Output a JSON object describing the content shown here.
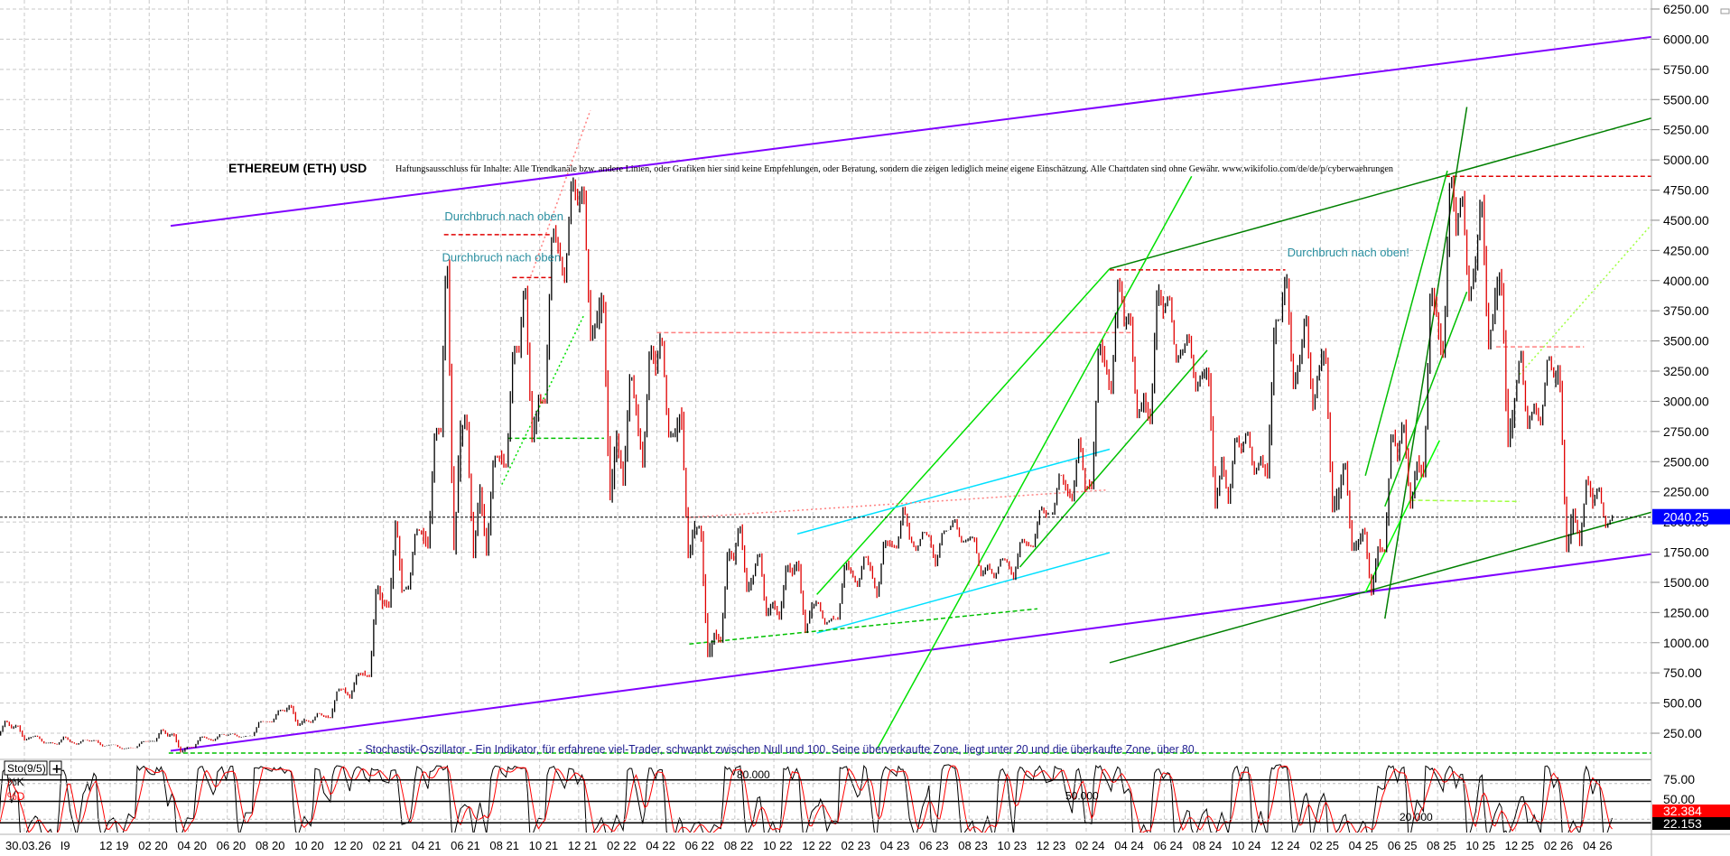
{
  "chart_data": {
    "type": "line",
    "title": "ETHEREUM (ETH) USD",
    "disclaimer": "Haftungsausschluss für Inhalte: Alle Trendkanäle bzw. andere Linien, oder Grafiken hier sind keine Empfehlungen, oder Beratung, sondern die zeigen lediglich meine eigene Einschätzung. Alle Chartdaten sind ohne Gewähr.  www.wikifolio.com/de/de/p/cyberwaehrungen",
    "stochastic_note": "- Stochastik-Oszillator - Ein Indikator, für erfahrene viel-Trader, schwankt zwischen Null und 100. Seine überverkaufte Zone, liegt unter 20 und die überkaufte Zone, über 80.",
    "annotations": [
      {
        "text": "Durchbruch nach oben",
        "date": "2021-05-05",
        "price": 4500
      },
      {
        "text": "Durchbruch nach oben",
        "date": "2021-05-01",
        "price": 4160
      },
      {
        "text": "Durchbruch nach oben!",
        "date": "2024-12-10",
        "price": 4200
      }
    ],
    "y_axis": {
      "ylim": [
        0,
        6400
      ],
      "ticks": [
        "6250.00",
        "6000.00",
        "5750.00",
        "5500.00",
        "5250.00",
        "5000.00",
        "4750.00",
        "4500.00",
        "4250.00",
        "4000.00",
        "3750.00",
        "3500.00",
        "3250.00",
        "3000.00",
        "2750.00",
        "2500.00",
        "2250.00",
        "2000.00",
        "1750.00",
        "1500.00",
        "1250.00",
        "1000.00",
        "750.00",
        "500.00",
        "250.00"
      ],
      "grid": true
    },
    "current_price": {
      "value": 2040.25,
      "label": "2040.25",
      "color": "#0000ff"
    },
    "x_tick_labels": [
      "30.03.26",
      "I9",
      "12 19",
      "02 20",
      "04 20",
      "06 20",
      "08 20",
      "10 20",
      "12 20",
      "02 21",
      "04 21",
      "06 21",
      "08 21",
      "10 21",
      "12 21",
      "02 22",
      "04 22",
      "06 22",
      "08 22",
      "10 22",
      "12 22",
      "02 23",
      "04 23",
      "06 23",
      "08 23",
      "10 23",
      "12 23",
      "02 24",
      "04 24",
      "06 24",
      "08 24",
      "10 24",
      "12 24",
      "02 25",
      "04 25",
      "06 25",
      "08 25",
      "10 25",
      "12 25",
      "02 26",
      "04 26"
    ],
    "price_monthly_hlc": [
      [
        "2019-06",
        360,
        230,
        290
      ],
      [
        "2019-07",
        320,
        190,
        218
      ],
      [
        "2019-08",
        230,
        165,
        172
      ],
      [
        "2019-09",
        225,
        155,
        180
      ],
      [
        "2019-10",
        200,
        155,
        182
      ],
      [
        "2019-11",
        195,
        140,
        152
      ],
      [
        "2019-12",
        155,
        118,
        130
      ],
      [
        "2020-01",
        185,
        127,
        180
      ],
      [
        "2020-02",
        288,
        180,
        225
      ],
      [
        "2020-03",
        250,
        90,
        133
      ],
      [
        "2020-04",
        227,
        130,
        207
      ],
      [
        "2020-05",
        245,
        185,
        231
      ],
      [
        "2020-06",
        250,
        215,
        226
      ],
      [
        "2020-07",
        350,
        226,
        345
      ],
      [
        "2020-08",
        445,
        340,
        434
      ],
      [
        "2020-09",
        488,
        310,
        360
      ],
      [
        "2020-10",
        420,
        335,
        386
      ],
      [
        "2020-11",
        620,
        375,
        615
      ],
      [
        "2020-12",
        750,
        535,
        737
      ],
      [
        "2021-01",
        1475,
        715,
        1314
      ],
      [
        "2021-02",
        2040,
        1290,
        1416
      ],
      [
        "2021-03",
        1945,
        1440,
        1918
      ],
      [
        "2021-04",
        2780,
        1780,
        2773
      ],
      [
        "2021-05",
        4360,
        1730,
        2700
      ],
      [
        "2021-06",
        2890,
        1700,
        2275
      ],
      [
        "2021-07",
        2550,
        1720,
        2536
      ],
      [
        "2021-08",
        3460,
        2450,
        3430
      ],
      [
        "2021-09",
        4020,
        2660,
        3000
      ],
      [
        "2021-10",
        4460,
        2980,
        4290
      ],
      [
        "2021-11",
        4870,
        3980,
        4630
      ],
      [
        "2021-12",
        4780,
        3500,
        3680
      ],
      [
        "2022-01",
        3900,
        2160,
        2690
      ],
      [
        "2022-02",
        3280,
        2300,
        2920
      ],
      [
        "2022-03",
        3480,
        2450,
        3280
      ],
      [
        "2022-04",
        3580,
        2700,
        2730
      ],
      [
        "2022-05",
        2950,
        1700,
        1940
      ],
      [
        "2022-06",
        1970,
        880,
        1070
      ],
      [
        "2022-07",
        1780,
        1000,
        1680
      ],
      [
        "2022-08",
        2020,
        1420,
        1550
      ],
      [
        "2022-09",
        1790,
        1220,
        1330
      ],
      [
        "2022-10",
        1660,
        1190,
        1570
      ],
      [
        "2022-11",
        1680,
        1080,
        1295
      ],
      [
        "2022-12",
        1350,
        1150,
        1196
      ],
      [
        "2023-01",
        1680,
        1190,
        1585
      ],
      [
        "2023-02",
        1740,
        1460,
        1605
      ],
      [
        "2023-03",
        1850,
        1370,
        1820
      ],
      [
        "2023-04",
        2140,
        1780,
        1870
      ],
      [
        "2023-05",
        1930,
        1760,
        1875
      ],
      [
        "2023-06",
        1930,
        1630,
        1934
      ],
      [
        "2023-07",
        2030,
        1830,
        1855
      ],
      [
        "2023-08",
        1880,
        1550,
        1645
      ],
      [
        "2023-09",
        1700,
        1530,
        1670
      ],
      [
        "2023-10",
        1860,
        1520,
        1815
      ],
      [
        "2023-11",
        2130,
        1790,
        2050
      ],
      [
        "2023-12",
        2420,
        2060,
        2280
      ],
      [
        "2024-01",
        2720,
        2170,
        2280
      ],
      [
        "2024-02",
        3520,
        2270,
        3340
      ],
      [
        "2024-03",
        4090,
        3060,
        3650
      ],
      [
        "2024-04",
        3730,
        2860,
        3010
      ],
      [
        "2024-05",
        3970,
        2810,
        3760
      ],
      [
        "2024-06",
        3890,
        3320,
        3430
      ],
      [
        "2024-07",
        3560,
        3080,
        3230
      ],
      [
        "2024-08",
        3280,
        2110,
        2510
      ],
      [
        "2024-09",
        2730,
        2150,
        2600
      ],
      [
        "2024-10",
        2770,
        2390,
        2520
      ],
      [
        "2024-11",
        3680,
        2360,
        3700
      ],
      [
        "2024-12",
        4110,
        3100,
        3330
      ],
      [
        "2025-01",
        3740,
        2920,
        3300
      ],
      [
        "2025-02",
        3440,
        2080,
        2240
      ],
      [
        "2025-03",
        2560,
        1760,
        1820
      ],
      [
        "2025-04",
        1960,
        1390,
        1790
      ],
      [
        "2025-05",
        2790,
        1750,
        2530
      ],
      [
        "2025-06",
        2880,
        2110,
        2490
      ],
      [
        "2025-07",
        3940,
        2370,
        3700
      ],
      [
        "2025-08",
        4950,
        3360,
        4400
      ],
      [
        "2025-09",
        4770,
        3830,
        4150
      ],
      [
        "2025-10",
        4750,
        3430,
        3850
      ],
      [
        "2025-11",
        4100,
        2620,
        3000
      ],
      [
        "2025-12",
        3450,
        2770,
        2970
      ],
      [
        "2026-01",
        3400,
        2800,
        3200
      ],
      [
        "2026-02",
        3300,
        1750,
        2100
      ],
      [
        "2026-03",
        2400,
        1800,
        2150
      ],
      [
        "2026-04",
        2300,
        1950,
        2040
      ]
    ],
    "trendlines": [
      {
        "from": [
          "2020-03-04",
          4454
        ],
        "to": [
          "2026-07-04",
          6022
        ],
        "color": "#8000ff",
        "style": "solid"
      },
      {
        "from": [
          "2020-03-04",
          104
        ],
        "to": [
          "2026-07-04",
          1737
        ],
        "color": "#8000ff",
        "style": "solid"
      },
      {
        "from": [
          "2024-03-07",
          4098
        ],
        "to": [
          "2026-07-13",
          5366
        ],
        "color": "#008000",
        "style": "solid"
      },
      {
        "from": [
          "2024-03-07",
          834
        ],
        "to": [
          "2026-07-13",
          2101
        ],
        "color": "#008000",
        "style": "solid"
      },
      {
        "from": [
          "2023-03-10",
          123
        ],
        "to": [
          "2024-07-13",
          4864
        ],
        "color": "#00e000",
        "style": "solid"
      },
      {
        "from": [
          "2022-12-07",
          1399
        ],
        "to": [
          "2024-03-07",
          4098
        ],
        "color": "#00e000",
        "style": "solid"
      },
      {
        "from": [
          "2023-10-19",
          1627
        ],
        "to": [
          "2024-08-07",
          3423
        ],
        "color": "#00c000",
        "style": "solid"
      },
      {
        "from": [
          "2022-11-07",
          1901
        ],
        "to": [
          "2024-03-07",
          2603
        ],
        "color": "#00e0ff",
        "style": "solid"
      },
      {
        "from": [
          "2022-12-07",
          1080
        ],
        "to": [
          "2024-03-07",
          1746
        ],
        "color": "#00e0ff",
        "style": "solid"
      },
      {
        "from": [
          "2022-05-21",
          989
        ],
        "to": [
          "2023-11-16",
          1281
        ],
        "color": "#00c000",
        "style": "dashed"
      },
      {
        "from": [
          "2021-08-12",
          2694
        ],
        "to": [
          "2022-01-10",
          2694
        ],
        "color": "#00c000",
        "style": "dashed"
      },
      {
        "from": [
          "2021-08-03",
          2311
        ],
        "to": [
          "2021-12-10",
          3724
        ],
        "color": "#00e000",
        "style": "dotted"
      },
      {
        "from": [
          "2021-09-15",
          4000
        ],
        "to": [
          "2021-12-19",
          5411
        ],
        "color": "#ff8080",
        "style": "dotted"
      },
      {
        "from": [
          "2021-05-04",
          4381
        ],
        "to": [
          "2021-10-19",
          4381
        ],
        "color": "#e00000",
        "style": "dashed"
      },
      {
        "from": [
          "2021-08-19",
          4025
        ],
        "to": [
          "2021-10-19",
          4025
        ],
        "color": "#e00000",
        "style": "dashed"
      },
      {
        "from": [
          "2022-04-01",
          3569
        ],
        "to": [
          "2024-04-10",
          3569
        ],
        "color": "#ff8080",
        "style": "dashed"
      },
      {
        "from": [
          "2024-03-07",
          4089
        ],
        "to": [
          "2024-12-07",
          4089
        ],
        "color": "#e00000",
        "style": "dashed"
      },
      {
        "from": [
          "2025-08-13",
          4864
        ],
        "to": [
          "2026-07-13",
          4864
        ],
        "color": "#e00000",
        "style": "dashed"
      },
      {
        "from": [
          "2022-05-21",
          2037
        ],
        "to": [
          "2024-03-01",
          2265
        ],
        "color": "#ff8080",
        "style": "dotted"
      },
      {
        "from": [
          "2025-11-01",
          3451
        ],
        "to": [
          "2026-03-16",
          3451
        ],
        "color": "#ff8080",
        "style": "dashed"
      },
      {
        "from": [
          "2025-05-10",
          1199
        ],
        "to": [
          "2025-09-16",
          5438
        ],
        "color": "#008000",
        "style": "solid"
      },
      {
        "from": [
          "2025-04-10",
          2384
        ],
        "to": [
          "2025-08-16",
          4910
        ],
        "color": "#00c000",
        "style": "solid"
      },
      {
        "from": [
          "2025-05-10",
          2129
        ],
        "to": [
          "2025-09-16",
          3907
        ],
        "color": "#00c000",
        "style": "solid"
      },
      {
        "from": [
          "2025-04-10",
          1417
        ],
        "to": [
          "2025-08-04",
          2676
        ],
        "color": "#00ff00",
        "style": "solid"
      },
      {
        "from": [
          "2025-12-07",
          3223
        ],
        "to": [
          "2026-07-13",
          4545
        ],
        "color": "#a0ff40",
        "style": "dotted"
      },
      {
        "from": [
          "2025-06-20",
          2180
        ],
        "to": [
          "2025-12-07",
          2170
        ],
        "color": "#a0ff40",
        "style": "dashed"
      },
      {
        "from": [
          "2020-03-01",
          86
        ],
        "to": [
          "2026-07-13",
          86
        ],
        "color": "#00c000",
        "style": "dashed"
      }
    ],
    "stochastic": {
      "label": "Sto(9/5)",
      "k_label": "%K",
      "d_label": "%D",
      "k_color": "#000000",
      "d_color": "#ff0000",
      "levels": [
        {
          "value": 80,
          "label": "80.000"
        },
        {
          "value": 50,
          "label": "50.000"
        },
        {
          "value": 20,
          "label": "20.000"
        }
      ],
      "axis_ticks": [
        "75.00",
        "50.00"
      ],
      "d_value": "32.384",
      "k_value": "22.153",
      "ylim": [
        0,
        100
      ]
    }
  }
}
